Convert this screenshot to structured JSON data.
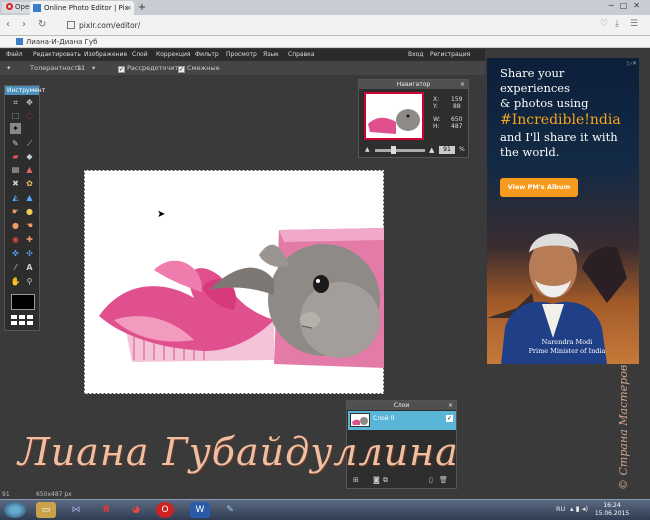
{
  "browser": {
    "menu_label": "Opera",
    "tab_title": "Online Photo Editor | Pix",
    "tab_close": "×",
    "new_tab": "+",
    "url": "pixlr.com/editor/",
    "bookmark": "Лиана-И-Диана Губ"
  },
  "menu": {
    "items": [
      "Файл",
      "Редактировать",
      "Изображение",
      "Слой",
      "Коррекция",
      "Фильтр",
      "Просмотр",
      "Язык",
      "Справка"
    ],
    "login": "Вход",
    "register": "Регистрация"
  },
  "options": {
    "tolerance_label": "Толерантность:",
    "tolerance_value": "21",
    "antialias_label": "Рассредоточить",
    "contiguous_label": "Смежные"
  },
  "tools": {
    "title": "Инструмент"
  },
  "navigator": {
    "title": "Навигатор",
    "close": "×",
    "x_label": "X:",
    "x_value": "159",
    "y_label": "Y:",
    "y_value": "88",
    "w_label": "W:",
    "w_value": "650",
    "h_label": "H:",
    "h_value": "487",
    "zoom_value": "91",
    "zoom_unit": "%"
  },
  "layers": {
    "title": "Слои",
    "close": "×",
    "layer_name": "Слой 0"
  },
  "ad": {
    "line1": "Share your experiences",
    "line2": "& photos using",
    "hashtag": "#Incredible!ndia",
    "line3": "and I'll share it with",
    "line4": "the world.",
    "button": "View PM's Album",
    "caption_name": "Narendra Modi",
    "caption_title": "Prime Minister of India"
  },
  "watermark": {
    "main": "Лиана Губайдуллина",
    "side": "© Страна Мастеров"
  },
  "status": {
    "zoom": "91",
    "size": "650x487 px"
  },
  "taskbar": {
    "lang": "RU",
    "time": "16:24",
    "date": "15.06.2015"
  },
  "colors": {
    "selected_layer": "#5ab6d6",
    "ad_button": "#f69b1d",
    "watermark": "#f0bfa1"
  }
}
